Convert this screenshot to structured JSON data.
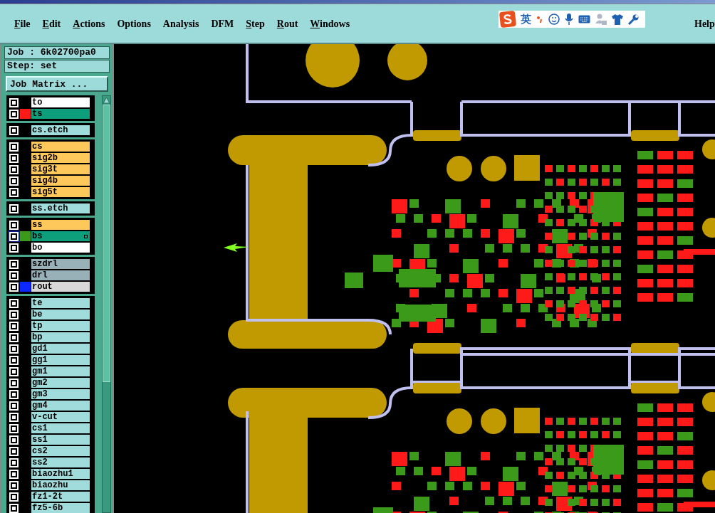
{
  "menu": [
    {
      "label": "File",
      "underline_first": true
    },
    {
      "label": "Edit",
      "underline_first": true
    },
    {
      "label": "Actions",
      "underline_first": true
    },
    {
      "label": "Options",
      "underline_first": false
    },
    {
      "label": "Analysis",
      "underline_first": false
    },
    {
      "label": "DFM",
      "underline_first": false
    },
    {
      "label": "Step",
      "underline_first": true
    },
    {
      "label": "Rout",
      "underline_first": true
    },
    {
      "label": "Windows",
      "underline_first": true
    }
  ],
  "help": "Help",
  "ime_toolbar": {
    "language": "英"
  },
  "job": "Job : 6k02700pa0",
  "step": "Step: set",
  "job_matrix_button": "Job Matrix ...",
  "layer_groups": [
    [
      {
        "name": "to",
        "kind": "silk",
        "focused": false
      },
      {
        "name": "ts",
        "kind": "mask",
        "color": "#ff1a1a",
        "focused": false
      }
    ],
    [
      {
        "name": "cs.etch",
        "kind": "misc",
        "focused": false
      }
    ],
    [
      {
        "name": "cs",
        "kind": "signal",
        "focused": false
      },
      {
        "name": "sig2b",
        "kind": "signal",
        "focused": false
      },
      {
        "name": "sig3t",
        "kind": "signal",
        "focused": false
      },
      {
        "name": "sig4b",
        "kind": "signal",
        "focused": false
      },
      {
        "name": "sig5t",
        "kind": "signal",
        "focused": false
      }
    ],
    [
      {
        "name": "ss.etch",
        "kind": "misc",
        "focused": false
      }
    ],
    [
      {
        "name": "ss",
        "kind": "signal",
        "focused": false
      },
      {
        "name": "bs",
        "kind": "mask",
        "color": "#3c9a1a",
        "focused": true
      },
      {
        "name": "bo",
        "kind": "silk",
        "focused": false
      }
    ],
    [
      {
        "name": "szdrl",
        "kind": "drill",
        "focused": false
      },
      {
        "name": "drl",
        "kind": "drill",
        "focused": false
      },
      {
        "name": "rout",
        "kind": "rout",
        "color": "#0a28ff",
        "focused": false
      }
    ],
    [
      {
        "name": "te",
        "kind": "misc",
        "focused": false
      },
      {
        "name": "be",
        "kind": "misc",
        "focused": false
      },
      {
        "name": "tp",
        "kind": "misc",
        "focused": false
      },
      {
        "name": "bp",
        "kind": "misc",
        "focused": false
      },
      {
        "name": "gd1",
        "kind": "misc",
        "focused": false
      },
      {
        "name": "gg1",
        "kind": "misc",
        "focused": false
      },
      {
        "name": "gm1",
        "kind": "misc",
        "focused": false
      },
      {
        "name": "gm2",
        "kind": "misc",
        "focused": false
      },
      {
        "name": "gm3",
        "kind": "misc",
        "focused": false
      },
      {
        "name": "gm4",
        "kind": "misc",
        "focused": false
      },
      {
        "name": "v-cut",
        "kind": "misc",
        "focused": false
      },
      {
        "name": "cs1",
        "kind": "misc",
        "focused": false
      },
      {
        "name": "ss1",
        "kind": "misc",
        "focused": false
      },
      {
        "name": "cs2",
        "kind": "misc",
        "focused": false
      },
      {
        "name": "ss2",
        "kind": "misc",
        "focused": false
      },
      {
        "name": "biaozhu1",
        "kind": "misc",
        "focused": false
      },
      {
        "name": "biaozhu",
        "kind": "misc",
        "focused": false
      },
      {
        "name": "fz1-2t",
        "kind": "misc",
        "focused": false
      },
      {
        "name": "fz5-6b",
        "kind": "misc",
        "focused": false
      }
    ]
  ]
}
